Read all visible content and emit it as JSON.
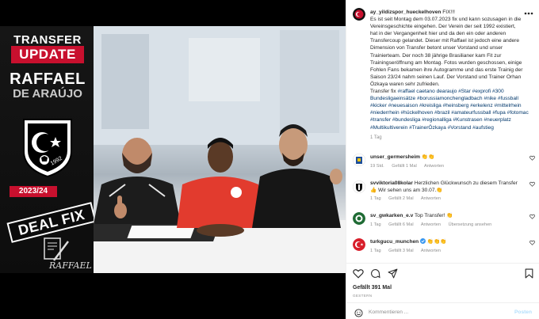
{
  "promo": {
    "transfer_word": "TRANSFER",
    "update_word": "UPDATE",
    "name_line1": "RAFFAEL",
    "name_line2": "DE ARAÚJO",
    "crest_year": "1992",
    "season": "2023/24",
    "deal_fix": "DEAL FIX",
    "signature": "RAFFAEL"
  },
  "colors": {
    "brand_red": "#c8102e",
    "link_blue": "#00376b",
    "meta_gray": "#8e8e8e"
  },
  "post": {
    "username": "ay_yildizspor_hueckelhoven",
    "caption_lines": [
      "FIX!!!",
      "Es ist seit Montag dem 03.07.2023 fix und kann sozusagen in die",
      "Vereinsgeschichte eingehen. Der Verein der seit 1992 existiert,",
      "hat in der Vergangenheit hier und da den ein oder anderen",
      "Transfercoup gelandet. Dieser mit Raffael ist jedoch eine andere",
      "Dimension von Transfer betont unser Vorstand und unser",
      "Trainierteam. Der noch 38 jährige Brasilianer kam Fit zur",
      "Trainingseröffnung am Montag. Fotos wurden geschossen, einige",
      "Fohlen Fans bekamen ihre Autogramme und das erste Trainig der",
      "Saison 23/24 nahm seinen Lauf. Der Vorstand und Trainer Orhan",
      "Özkaya waren sehr zufrieden."
    ],
    "caption_tags_lead": "Transfer fix",
    "hashtags": "#raffael caetano dearaujo #Star #exprofi #300 Bundesligaeinsätze #borussiamonchengladbach #nike #fussball #kicker #neuesaison #kreisliga #heinsberg #erkelenz #mittelrhein #niederrhein #hückelhoven #brazil #amateurfussball #fupa #fotomac #transfer #bundesliga #regionalliga #Kunstrasen #neuerplatz #Multikultiverein #TrainerÖzkaya #Vorstand #aufstieg",
    "caption_age": "1 Tag",
    "likes": "Gefällt 391 Mal",
    "date": "GESTERN",
    "comment_placeholder": "Kommentieren ...",
    "post_button": "Posten"
  },
  "comments": [
    {
      "user": "unser_germersheim",
      "text": "👏👏",
      "age": "19 Std.",
      "likes": "Gefällt 1 Mal",
      "reply": "Antworten",
      "extra": ""
    },
    {
      "user": "svviktoria08kolar",
      "text": "Herzlichen Glückwunsch zu diesem Transfer 👍 Wir sehen uns am 30.07.👏",
      "age": "1 Tag",
      "likes": "Gefällt 2 Mal",
      "reply": "Antworten",
      "extra": ""
    },
    {
      "user": "sv_gwkarken_e.v",
      "text": "Top Transfer! 👏",
      "age": "1 Tag",
      "likes": "Gefällt 6 Mal",
      "reply": "Antworten",
      "extra": "Übersetzung ansehen"
    },
    {
      "user": "turkgucu_munchen",
      "text": "👏👏👏",
      "age": "1 Tag",
      "likes": "Gefällt 3 Mal",
      "reply": "Antworten",
      "extra": ""
    }
  ],
  "icons": {
    "options": "more-icon",
    "like": "heart-icon",
    "comment": "comment-icon",
    "share": "share-icon",
    "save": "bookmark-icon",
    "emoji": "smiley-icon",
    "verified": "verified-badge-icon"
  }
}
